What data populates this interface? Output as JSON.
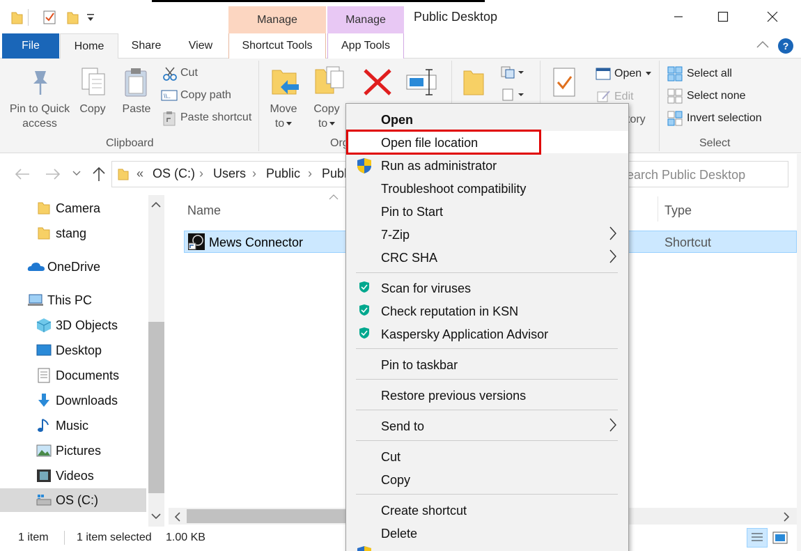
{
  "window": {
    "title": "Public Desktop",
    "manage_shortcut": "Manage",
    "manage_app": "Manage",
    "colors": {
      "accent": "#1a66b8",
      "shortcut_tools_bg": "#fcd6c1",
      "app_tools_bg": "#e8c8f4",
      "selection": "#cce8ff",
      "highlight_box": "#e00000"
    }
  },
  "tabs": {
    "file": "File",
    "home": "Home",
    "share": "Share",
    "view": "View",
    "shortcut_tools": "Shortcut Tools",
    "app_tools": "App Tools"
  },
  "ribbon": {
    "clipboard": {
      "pin_line1": "Pin to Quick",
      "pin_line2": "access",
      "copy": "Copy",
      "paste": "Paste",
      "cut": "Cut",
      "copy_path": "Copy path",
      "paste_shortcut": "Paste shortcut",
      "group_label": "Clipboard"
    },
    "organize": {
      "move_line1": "Move",
      "move_line2": "to",
      "copy_line1": "Copy",
      "copy_line2": "to",
      "group_label_partial": "Org"
    },
    "open": {
      "open": "Open",
      "edit": "Edit",
      "history_partial": "tory"
    },
    "select": {
      "select_all": "Select all",
      "select_none": "Select none",
      "invert_selection": "Invert selection",
      "group_label": "Select"
    }
  },
  "address": {
    "prefix": "«",
    "crumbs": [
      "OS (C:)",
      "Users",
      "Public",
      "Publ"
    ],
    "search_placeholder": "earch Public Desktop"
  },
  "nav_pane": {
    "items": [
      {
        "label": "Camera",
        "icon": "folder-icon"
      },
      {
        "label": "stang",
        "icon": "folder-icon"
      },
      {
        "label": "OneDrive",
        "icon": "cloud-icon"
      },
      {
        "label": "This PC",
        "icon": "computer-icon"
      },
      {
        "label": "3D Objects",
        "icon": "cube-icon"
      },
      {
        "label": "Desktop",
        "icon": "desktop-icon"
      },
      {
        "label": "Documents",
        "icon": "document-icon"
      },
      {
        "label": "Downloads",
        "icon": "download-icon"
      },
      {
        "label": "Music",
        "icon": "music-icon"
      },
      {
        "label": "Pictures",
        "icon": "pictures-icon"
      },
      {
        "label": "Videos",
        "icon": "videos-icon"
      },
      {
        "label": "OS (C:)",
        "icon": "drive-icon"
      }
    ]
  },
  "file_list": {
    "columns": {
      "name": "Name",
      "type": "Type"
    },
    "rows": [
      {
        "name": "Mews Connector",
        "type": "Shortcut"
      }
    ]
  },
  "status_bar": {
    "count": "1 item",
    "selected": "1 item selected",
    "size": "1.00 KB"
  },
  "context_menu": {
    "open": "Open",
    "open_file_location": "Open file location",
    "run_as_admin": "Run as administrator",
    "troubleshoot": "Troubleshoot compatibility",
    "pin_to_start": "Pin to Start",
    "seven_zip": "7-Zip",
    "crc_sha": "CRC SHA",
    "scan_viruses": "Scan for viruses",
    "check_reputation": "Check reputation in KSN",
    "kaspersky_advisor": "Kaspersky Application Advisor",
    "pin_taskbar": "Pin to taskbar",
    "restore_versions": "Restore previous versions",
    "send_to": "Send to",
    "cut": "Cut",
    "copy": "Copy",
    "create_shortcut": "Create shortcut",
    "delete": "Delete"
  }
}
